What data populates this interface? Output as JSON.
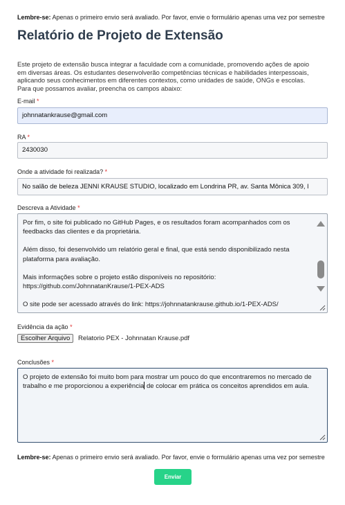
{
  "notice": {
    "bold": "Lembre-se:",
    "text": " Apenas o primeiro envio será avaliado. Por favor, envie o formulário apenas uma vez por semestre"
  },
  "title": "Relatório de Projeto de Extensão",
  "intro": "Este projeto de extensão busca integrar a faculdade com a comunidade, promovendo ações de apoio em diversas áreas. Os estudantes desenvolverão competências técnicas e habilidades interpessoais, aplicando seus conhecimentos em diferentes contextos, como unidades de saúde, ONGs e escolas. Para que possamos avaliar, preencha os campos abaixo:",
  "required_mark": "*",
  "email": {
    "label": "E-mail",
    "value": "johnnatankrause@gmail.com"
  },
  "ra": {
    "label": "RA",
    "value": "2430030"
  },
  "local": {
    "label": "Onde a atividade foi realizada?",
    "value": "No salão de beleza JENNI KRAUSE STUDIO, localizado em Londrina PR, av. Santa Mônica 309, l"
  },
  "atividade": {
    "label": "Descreva a Atividade",
    "paragraphs": [
      "Por fim, o site foi publicado no GitHub Pages, e os resultados foram acompanhados com os feedbacks das clientes e da proprietária.",
      "Além disso, foi desenvolvido um relatório geral e final, que está sendo disponibilizado nesta plataforma para avaliação.",
      "Mais informações sobre o projeto estão disponíveis no repositório: https://github.com/JohnnatanKrause/1-PEX-ADS",
      "O site pode ser acessado através do link: https://johnnatankrause.github.io/1-PEX-ADS/"
    ]
  },
  "evidencia": {
    "label": "Evidência da ação",
    "button": "Escolher Arquivo",
    "filename": "Relatorio PEX - Johnnatan Krause.pdf"
  },
  "conclusoes": {
    "label": "Conclusões",
    "text_before_caret": "O projeto de extensão foi muito bom para mostrar um pouco do que encontraremos no mercado de trabalho e me proporcionou a experiência",
    "text_after_caret": " de colocar em prática os conceitos aprendidos em aula."
  },
  "submit": "Enviar",
  "colors": {
    "title": "#2f3d4d",
    "required": "#e03131",
    "submit_bg": "#27d389",
    "email_bg": "#e8eefc"
  }
}
